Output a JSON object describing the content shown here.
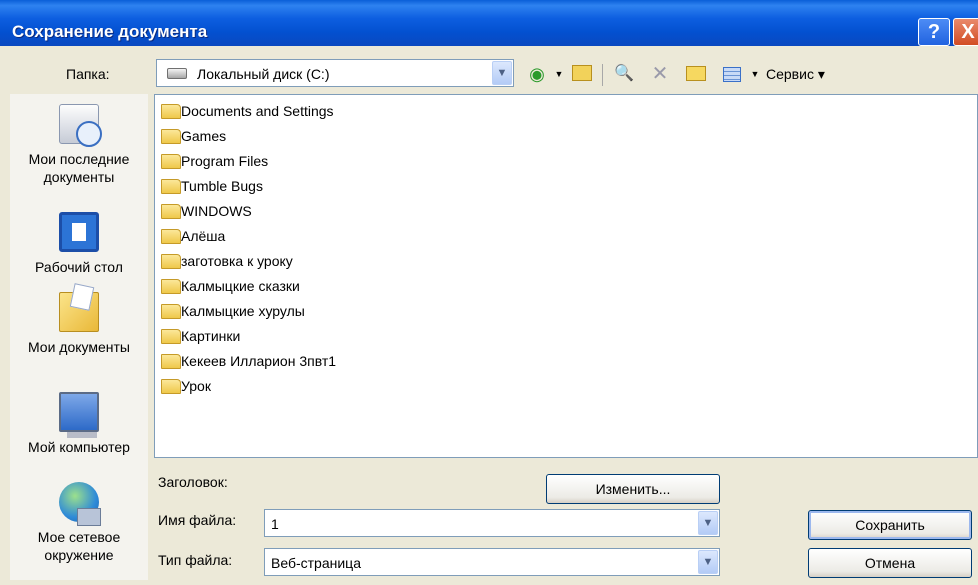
{
  "window": {
    "title": "Сохранение документа",
    "help_label": "?",
    "close_label": "X"
  },
  "toolbar": {
    "folder_label": "Папка:",
    "folder_value": "Локальный диск (C:)",
    "back_icon": "back-icon",
    "tools_label": "Сервис"
  },
  "places": [
    {
      "label": "Мои последние документы",
      "icon": "recent-documents-icon"
    },
    {
      "label": "Рабочий стол",
      "icon": "desktop-icon"
    },
    {
      "label": "Мои документы",
      "icon": "my-documents-icon"
    },
    {
      "label": "Мой компьютер",
      "icon": "my-computer-icon"
    },
    {
      "label": "Мое сетевое окружение",
      "icon": "network-icon"
    }
  ],
  "files": [
    "Documents and Settings",
    "Games",
    "Program Files",
    "Tumble Bugs",
    "WINDOWS",
    "Алёша",
    "заготовка к уроку",
    "Калмыцкие сказки",
    "Калмыцкие хурулы",
    "Картинки",
    "Кекеев Илларион  3пвт1",
    "Урок"
  ],
  "form": {
    "title_label": "Заголовок:",
    "change_button": "Изменить...",
    "filename_label": "Имя файла:",
    "filename_value": "1",
    "filetype_label": "Тип файла:",
    "filetype_value": "Веб-страница",
    "save_button": "Сохранить",
    "cancel_button": "Отмена"
  },
  "colors": {
    "titlebar": "#0a5fd8",
    "dialog_bg": "#ece9d8",
    "field_border": "#7f9db9"
  }
}
